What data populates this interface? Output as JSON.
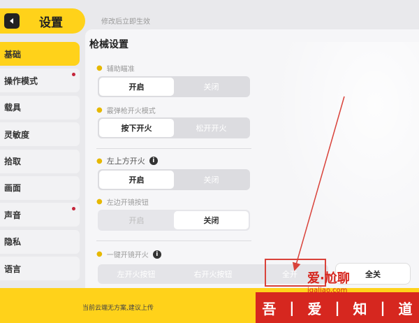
{
  "header": {
    "title": "设置",
    "hint": "修改后立即生效"
  },
  "sidebar": {
    "items": [
      {
        "label": "基础",
        "active": true,
        "dot": false
      },
      {
        "label": "操作模式",
        "active": false,
        "dot": true
      },
      {
        "label": "载具",
        "active": false,
        "dot": false
      },
      {
        "label": "灵敏度",
        "active": false,
        "dot": false
      },
      {
        "label": "拾取",
        "active": false,
        "dot": false
      },
      {
        "label": "画面",
        "active": false,
        "dot": false
      },
      {
        "label": "声音",
        "active": false,
        "dot": true
      },
      {
        "label": "隐私",
        "active": false,
        "dot": false
      },
      {
        "label": "语言",
        "active": false,
        "dot": false
      }
    ]
  },
  "main": {
    "section_title": "枪械设置",
    "groups": {
      "aim_assist": {
        "label": "辅助瞄准",
        "on": "开启",
        "off": "关闭",
        "selected": "on"
      },
      "fire_mode": {
        "label": "霰弹枪开火模式",
        "opt1": "按下开火",
        "opt2": "松开开火",
        "selected": "opt1"
      },
      "top_left_fire": {
        "label": "左上方开火",
        "on": "开启",
        "off": "关闭",
        "selected": "on"
      },
      "left_scope": {
        "label": "左边开镜按钮",
        "on": "开启",
        "off": "关闭",
        "selected": "off"
      },
      "one_key_scope": {
        "label": "一键开镜开火",
        "options": [
          "左开火按钮",
          "右开火按钮",
          "全开"
        ],
        "all_off": "全关"
      }
    },
    "bottom_hint": "当前云端无方案,建议上传"
  },
  "watermark": {
    "brand": "爱·尬聊",
    "url": "igaliao.com",
    "strip": [
      "吾",
      "|",
      "爱",
      "|",
      "知",
      "|",
      "道"
    ]
  },
  "colors": {
    "accent": "#ffd21a",
    "annotation": "#d9423a",
    "dot": "#c4243a"
  }
}
